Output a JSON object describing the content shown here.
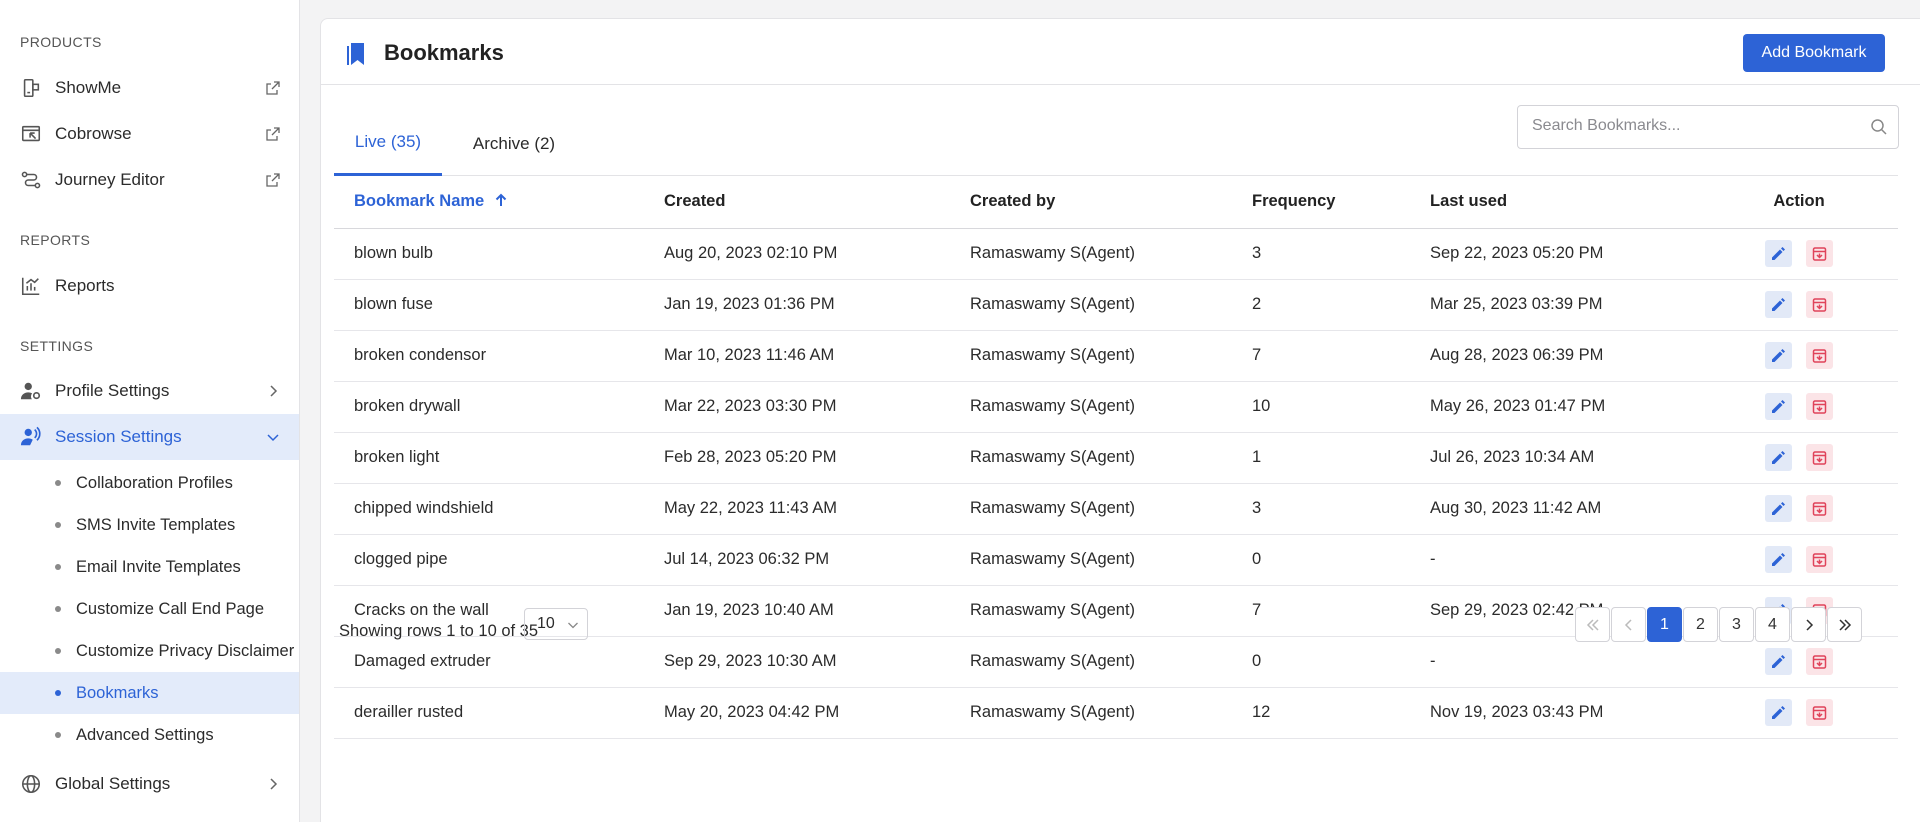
{
  "sidebar": {
    "sections": {
      "products": "PRODUCTS",
      "reports": "REPORTS",
      "settings": "SETTINGS"
    },
    "products": [
      {
        "label": "ShowMe",
        "icon": "showme-icon"
      },
      {
        "label": "Cobrowse",
        "icon": "cobrowse-icon"
      },
      {
        "label": "Journey Editor",
        "icon": "journey-editor-icon"
      }
    ],
    "reports": [
      {
        "label": "Reports",
        "icon": "reports-icon"
      }
    ],
    "settings": [
      {
        "label": "Profile Settings",
        "icon": "profile-settings-icon"
      },
      {
        "label": "Session Settings",
        "icon": "session-settings-icon"
      }
    ],
    "session_sub": [
      {
        "label": "Collaboration Profiles"
      },
      {
        "label": "SMS Invite Templates"
      },
      {
        "label": "Email Invite Templates"
      },
      {
        "label": "Customize Call End Page"
      },
      {
        "label": "Customize Privacy Disclaimer"
      },
      {
        "label": "Bookmarks"
      },
      {
        "label": "Advanced Settings"
      }
    ],
    "global": {
      "label": "Global Settings",
      "icon": "globe-icon"
    }
  },
  "header": {
    "title": "Bookmarks",
    "add_button": "Add Bookmark"
  },
  "tabs": [
    {
      "label": "Live (35)",
      "active": true
    },
    {
      "label": "Archive (2)",
      "active": false
    }
  ],
  "search": {
    "placeholder": "Search Bookmarks..."
  },
  "table": {
    "columns": [
      "Bookmark Name",
      "Created",
      "Created by",
      "Frequency",
      "Last used",
      "Action"
    ],
    "rows": [
      [
        "blown bulb",
        "Aug 20, 2023 02:10 PM",
        "Ramaswamy S(Agent)",
        "3",
        "Sep 22, 2023 05:20 PM"
      ],
      [
        "blown fuse",
        "Jan 19, 2023 01:36 PM",
        "Ramaswamy S(Agent)",
        "2",
        "Mar 25, 2023 03:39 PM"
      ],
      [
        "broken condensor",
        "Mar 10, 2023 11:46 AM",
        "Ramaswamy S(Agent)",
        "7",
        "Aug 28, 2023 06:39 PM"
      ],
      [
        "broken drywall",
        "Mar 22, 2023 03:30 PM",
        "Ramaswamy S(Agent)",
        "10",
        "May 26, 2023 01:47 PM"
      ],
      [
        "broken light",
        "Feb 28, 2023 05:20 PM",
        "Ramaswamy S(Agent)",
        "1",
        "Jul 26, 2023 10:34 AM"
      ],
      [
        "chipped windshield",
        "May 22, 2023 11:43 AM",
        "Ramaswamy S(Agent)",
        "3",
        "Aug 30, 2023 11:42 AM"
      ],
      [
        "clogged pipe",
        "Jul 14, 2023 06:32 PM",
        "Ramaswamy S(Agent)",
        "0",
        "-"
      ],
      [
        "Cracks on the wall",
        "Jan 19, 2023 10:40 AM",
        "Ramaswamy S(Agent)",
        "7",
        "Sep 29, 2023 02:42 PM"
      ],
      [
        "Damaged extruder",
        "Sep 29, 2023 10:30 AM",
        "Ramaswamy S(Agent)",
        "0",
        "-"
      ],
      [
        "derailler rusted",
        "May 20, 2023 04:42 PM",
        "Ramaswamy S(Agent)",
        "12",
        "Nov 19, 2023 03:43 PM"
      ]
    ]
  },
  "footer": {
    "showing": "Showing rows 1 to 10 of 35",
    "page_size": "10",
    "pages": [
      "1",
      "2",
      "3",
      "4"
    ],
    "current_page": "1"
  },
  "colors": {
    "accent": "#2d63d6",
    "active_bg": "#e3ebfa",
    "edit_bg": "#e2e9f7",
    "delete_bg": "#fbe4e7",
    "delete": "#e0435a"
  }
}
